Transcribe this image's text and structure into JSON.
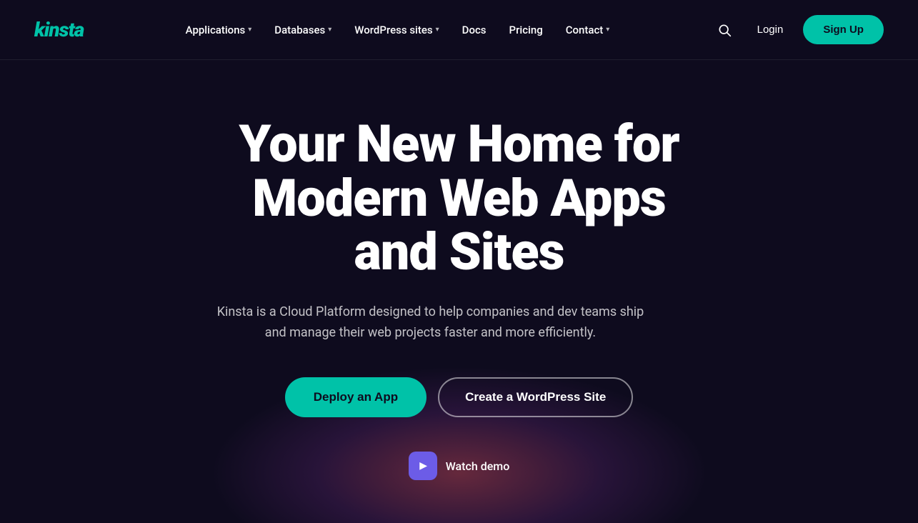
{
  "nav": {
    "logo": "kinsta",
    "links": [
      {
        "label": "Applications",
        "hasDropdown": true
      },
      {
        "label": "Databases",
        "hasDropdown": true
      },
      {
        "label": "WordPress sites",
        "hasDropdown": true
      },
      {
        "label": "Docs",
        "hasDropdown": false
      },
      {
        "label": "Pricing",
        "hasDropdown": false
      },
      {
        "label": "Contact",
        "hasDropdown": true
      }
    ],
    "login_label": "Login",
    "signup_label": "Sign Up"
  },
  "hero": {
    "title": "Your New Home for Modern Web Apps and Sites",
    "subtitle": "Kinsta is a Cloud Platform designed to help companies and dev teams ship and manage their web projects faster and more efficiently.",
    "btn_primary": "Deploy an App",
    "btn_secondary": "Create a WordPress Site",
    "watch_demo": "Watch demo"
  }
}
